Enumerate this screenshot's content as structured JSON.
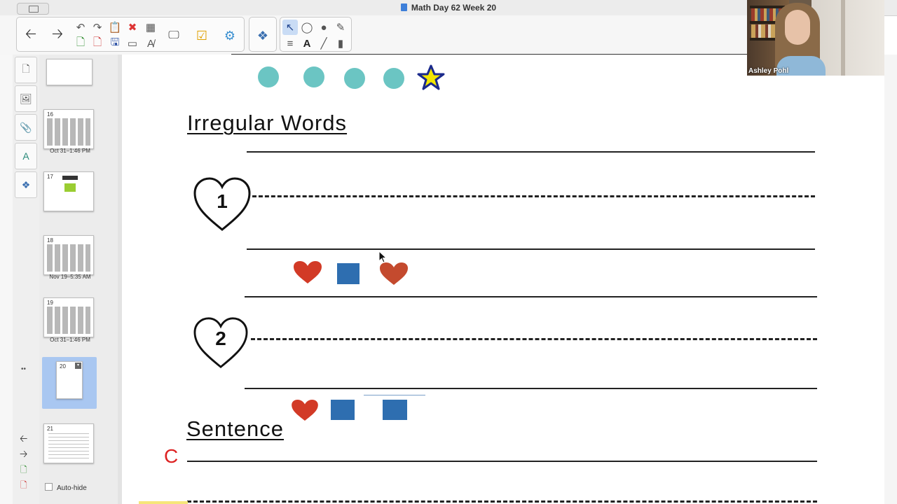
{
  "window": {
    "title": "Math Day 62 Week 20"
  },
  "toolbar": {
    "back_icon": "arrow-left-icon",
    "forward_icon": "arrow-right-icon"
  },
  "sorter": {
    "thumbnails": [
      {
        "number": "",
        "date": ""
      },
      {
        "number": "16",
        "date": "Oct 31–1:46 PM"
      },
      {
        "number": "17",
        "date": ""
      },
      {
        "number": "18",
        "date": "Nov 19–5:35 AM"
      },
      {
        "number": "19",
        "date": "Oct 31–1:46 PM"
      },
      {
        "number": "20",
        "date": ""
      },
      {
        "number": "21",
        "date": ""
      }
    ],
    "auto_hide_label": "Auto-hide"
  },
  "page": {
    "heading_irregular": "Irregular Words",
    "heart_1": "1",
    "heart_2": "2",
    "heading_sentence": "Sentence",
    "sentence_start_letter": "C",
    "colors": {
      "teal_dot": "#6bc5c3",
      "heart_red": "#d23a26",
      "square_blue": "#2e6eb0",
      "star_fill": "#f2e600",
      "star_outline": "#1b2a8c"
    }
  },
  "webcam": {
    "participant_name": "Ashley Pohl"
  }
}
